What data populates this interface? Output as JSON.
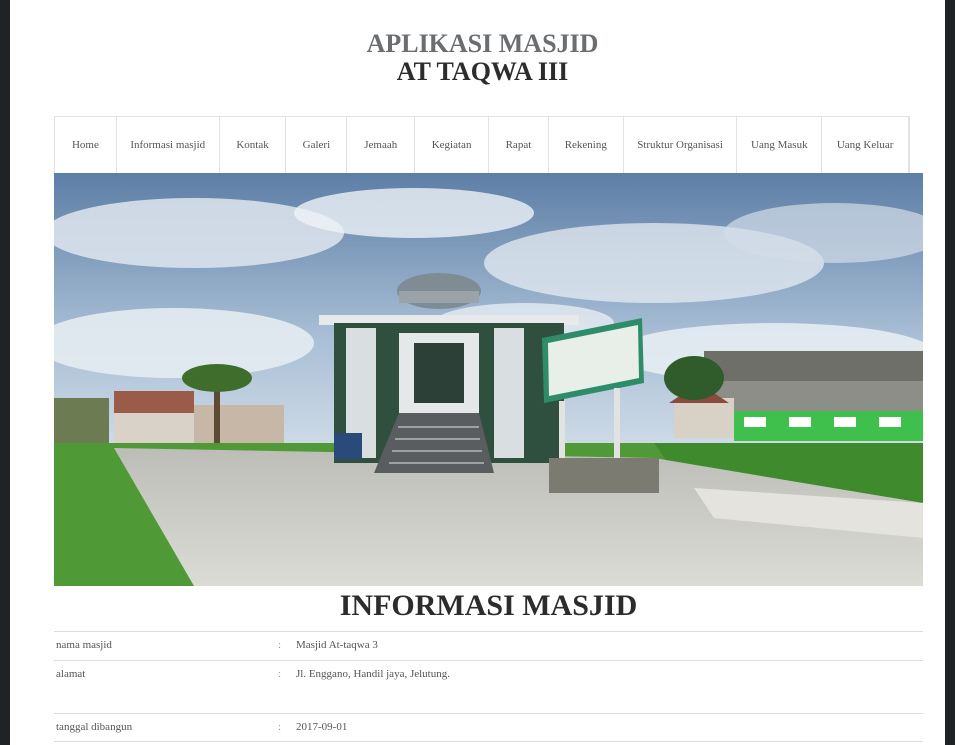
{
  "header": {
    "title": "APLIKASI MASJID",
    "subtitle": "AT TAQWA III"
  },
  "nav": {
    "items": [
      {
        "label": "Home"
      },
      {
        "label": "Informasi masjid"
      },
      {
        "label": "Kontak"
      },
      {
        "label": "Galeri"
      },
      {
        "label": "Jemaah"
      },
      {
        "label": "Kegiatan"
      },
      {
        "label": "Rapat"
      },
      {
        "label": "Rekening"
      },
      {
        "label": "Struktur Organisasi"
      },
      {
        "label": "Uang Masuk"
      },
      {
        "label": "Uang Keluar"
      }
    ]
  },
  "section": {
    "title": "INFORMASI MASJID"
  },
  "info": {
    "separator": ":",
    "rows": [
      {
        "label": "nama masjid",
        "value": "Masjid At-taqwa 3"
      },
      {
        "label": "alamat",
        "value": "Jl. Enggano, Handil jaya, Jelutung."
      },
      {
        "label": "tanggal dibangun",
        "value": "2017-09-01"
      }
    ]
  },
  "colors": {
    "sidebar": "#202326",
    "title_gray": "#6b6e70",
    "title_dark": "#2c2c2c"
  }
}
